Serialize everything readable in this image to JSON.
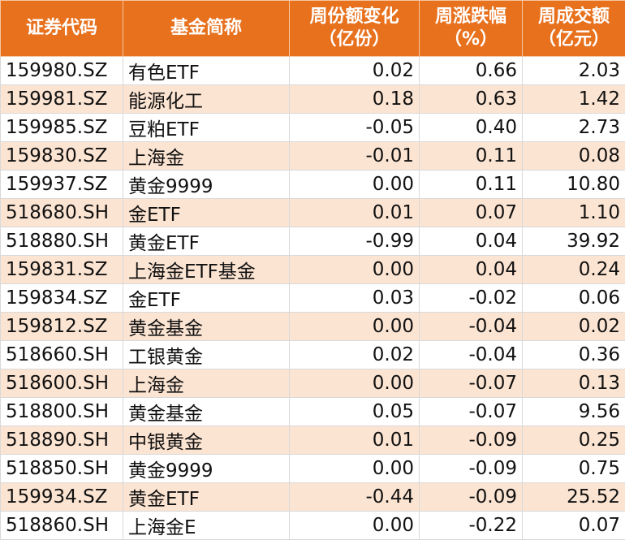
{
  "chart_data": {
    "type": "table",
    "columns": [
      {
        "line1": "证券代码",
        "line2": ""
      },
      {
        "line1": "基金简称",
        "line2": ""
      },
      {
        "line1": "周份额变化",
        "line2": "（亿份）"
      },
      {
        "line1": "周涨跌幅",
        "line2": "（%）"
      },
      {
        "line1": "周成交额",
        "line2": "（亿元）"
      }
    ],
    "rows": [
      {
        "code": "159980.SZ",
        "name": "有色ETF",
        "share_change": "0.02",
        "weekly_change": "0.66",
        "turnover": "2.03"
      },
      {
        "code": "159981.SZ",
        "name": "能源化工",
        "share_change": "0.18",
        "weekly_change": "0.63",
        "turnover": "1.42"
      },
      {
        "code": "159985.SZ",
        "name": "豆粕ETF",
        "share_change": "-0.05",
        "weekly_change": "0.40",
        "turnover": "2.73"
      },
      {
        "code": "159830.SZ",
        "name": "上海金",
        "share_change": "-0.01",
        "weekly_change": "0.11",
        "turnover": "0.08"
      },
      {
        "code": "159937.SZ",
        "name": "黄金9999",
        "share_change": "0.00",
        "weekly_change": "0.11",
        "turnover": "10.80"
      },
      {
        "code": "518680.SH",
        "name": "金ETF",
        "share_change": "0.01",
        "weekly_change": "0.07",
        "turnover": "1.10"
      },
      {
        "code": "518880.SH",
        "name": "黄金ETF",
        "share_change": "-0.99",
        "weekly_change": "0.04",
        "turnover": "39.92"
      },
      {
        "code": "159831.SZ",
        "name": "上海金ETF基金",
        "share_change": "0.00",
        "weekly_change": "0.04",
        "turnover": "0.24"
      },
      {
        "code": "159834.SZ",
        "name": "金ETF",
        "share_change": "0.03",
        "weekly_change": "-0.02",
        "turnover": "0.06"
      },
      {
        "code": "159812.SZ",
        "name": "黄金基金",
        "share_change": "0.00",
        "weekly_change": "-0.04",
        "turnover": "0.02"
      },
      {
        "code": "518660.SH",
        "name": "工银黄金",
        "share_change": "0.02",
        "weekly_change": "-0.04",
        "turnover": "0.36"
      },
      {
        "code": "518600.SH",
        "name": "上海金",
        "share_change": "0.00",
        "weekly_change": "-0.07",
        "turnover": "0.13"
      },
      {
        "code": "518800.SH",
        "name": "黄金基金",
        "share_change": "0.05",
        "weekly_change": "-0.07",
        "turnover": "9.56"
      },
      {
        "code": "518890.SH",
        "name": "中银黄金",
        "share_change": "0.01",
        "weekly_change": "-0.09",
        "turnover": "0.25"
      },
      {
        "code": "518850.SH",
        "name": "黄金9999",
        "share_change": "0.00",
        "weekly_change": "-0.09",
        "turnover": "0.75"
      },
      {
        "code": "159934.SZ",
        "name": "黄金ETF",
        "share_change": "-0.44",
        "weekly_change": "-0.09",
        "turnover": "25.52"
      },
      {
        "code": "518860.SH",
        "name": "上海金E",
        "share_change": "0.00",
        "weekly_change": "-0.22",
        "turnover": "0.07"
      }
    ]
  },
  "colors": {
    "header_bg": "#e8711e",
    "header_text": "#ffffff",
    "row_stripe": "#fce4d2",
    "row_plain": "#ffffff"
  }
}
